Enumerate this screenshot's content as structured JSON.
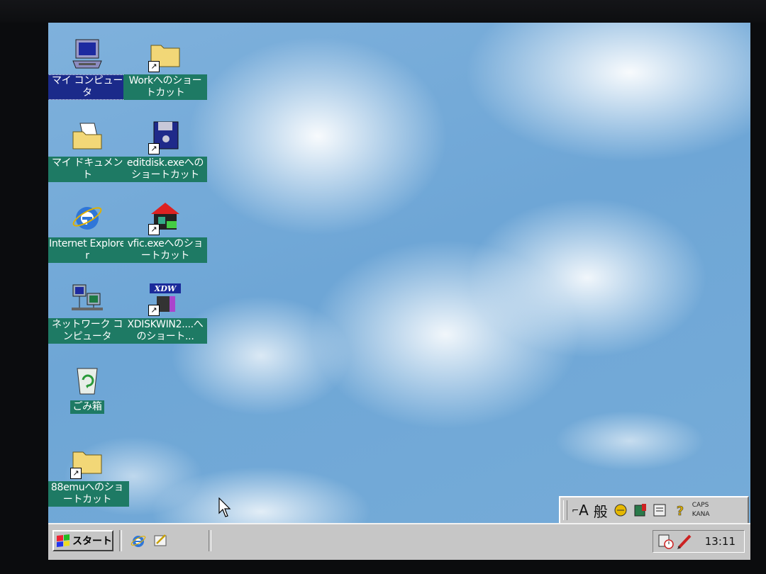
{
  "desktop": {
    "icons": [
      {
        "label": "マイ コンピュータ",
        "icon": "my-computer-icon",
        "shortcut": false,
        "selected": true
      },
      {
        "label": "マイ ドキュメント",
        "icon": "my-documents-icon",
        "shortcut": false,
        "selected": false
      },
      {
        "label": "Internet Explorer",
        "icon": "internet-explorer-icon",
        "shortcut": false,
        "selected": false
      },
      {
        "label": "ネットワーク コンピュータ",
        "icon": "network-computer-icon",
        "shortcut": false,
        "selected": false
      },
      {
        "label": "ごみ箱",
        "icon": "recycle-bin-icon",
        "shortcut": false,
        "selected": false
      },
      {
        "label": "88emuへのショートカット",
        "icon": "folder-icon",
        "shortcut": true,
        "selected": false
      },
      {
        "label": "Workへのショートカット",
        "icon": "folder-icon",
        "shortcut": true,
        "selected": false
      },
      {
        "label": "editdisk.exeへのショートカット",
        "icon": "floppy-disk-icon",
        "shortcut": true,
        "selected": false
      },
      {
        "label": "vfic.exeへのショートカット",
        "icon": "vfic-app-icon",
        "shortcut": true,
        "selected": false
      },
      {
        "label": "XDISKWIN2....へのショート...",
        "icon": "xdw-app-icon",
        "shortcut": true,
        "selected": false
      }
    ]
  },
  "taskbar": {
    "start_label": "スタート",
    "quick_launch": [
      {
        "icon": "internet-explorer-icon"
      },
      {
        "icon": "outlook-express-icon"
      }
    ],
    "tray": {
      "icons": [
        "task-scheduler-icon",
        "pen-icon"
      ],
      "clock": "13:11"
    }
  },
  "language_bar": {
    "items": [
      "A",
      "般"
    ],
    "caps": "CAPS",
    "kana": "KANA"
  },
  "colors": {
    "label_bg": "#1e7a64",
    "selected_bg": "#1b2a8a",
    "taskbar": "#c6c6c6"
  }
}
